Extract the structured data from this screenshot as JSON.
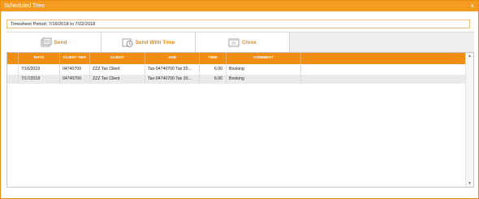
{
  "window": {
    "title": "Scheduled Time",
    "close_glyph": "×"
  },
  "period": {
    "text": "Timesheet Period: 7/16/2018 to 7/22/2018"
  },
  "toolbar": {
    "send_label": "Send",
    "send_with_time_label": "Send With Time",
    "close_label": "Close"
  },
  "table": {
    "columns": [
      "DATE",
      "CLIENT REF",
      "CLIENT",
      "JOB",
      "TIME",
      "COMMENT"
    ],
    "rows": [
      {
        "date": "7/16/2018",
        "client_ref": "04740700",
        "client": "ZZZ Tax Client",
        "job": "Tax-04740700 Tax 20...",
        "time": "6.00",
        "comment": "Booking"
      },
      {
        "date": "7/17/2018",
        "client_ref": "04740700",
        "client": "ZZZ Tax Client",
        "job": "Tax-04740700 Tax 20...",
        "time": "6.00",
        "comment": "Booking"
      }
    ]
  },
  "colors": {
    "accent": "#f39a1f",
    "header": "#f08e14",
    "button_text": "#e98a12"
  }
}
